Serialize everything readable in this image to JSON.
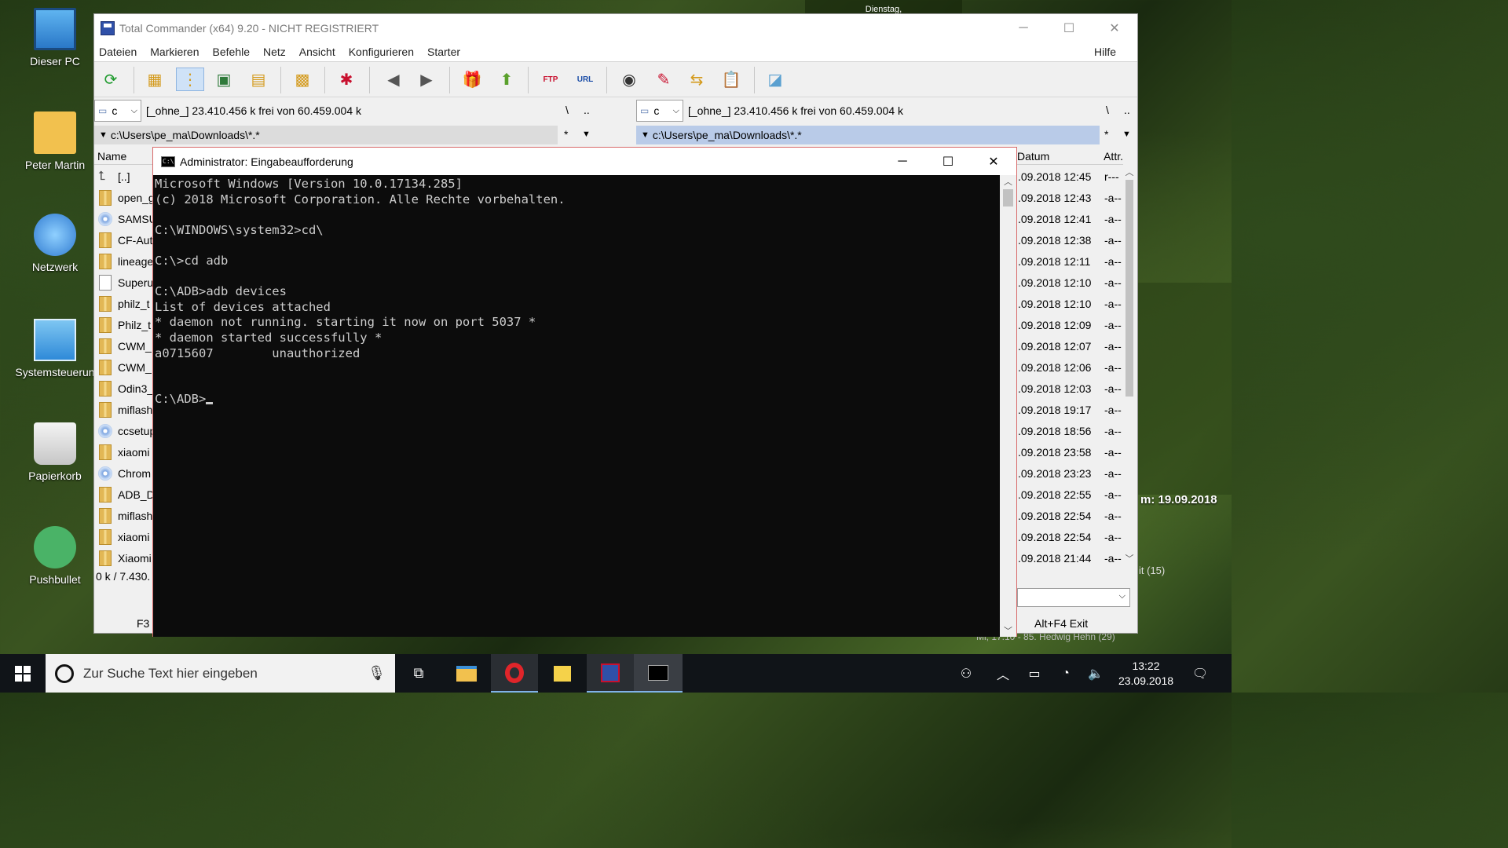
{
  "desktop": {
    "icons": [
      {
        "label": "Dieser PC",
        "icon": "computer-icon"
      },
      {
        "label": "Peter Martin",
        "icon": "user-folder-icon"
      },
      {
        "label": "Netzwerk",
        "icon": "network-globe-icon"
      },
      {
        "label": "Systemsteuerun",
        "icon": "control-panel-icon"
      },
      {
        "label": "Papierkorb",
        "icon": "recycle-bin-icon"
      },
      {
        "label": "Pushbullet",
        "icon": "pushbullet-icon"
      }
    ],
    "widget": {
      "day": "Dienstag,",
      "date_line": "m: 19.09.2018",
      "count": "it (15)",
      "footer": "Mi, 17.10 - 85. Hedwig Hehn (29)"
    }
  },
  "tc": {
    "title": "Total Commander (x64) 9.20 - NICHT REGISTRIERT",
    "menu": [
      "Dateien",
      "Markieren",
      "Befehle",
      "Netz",
      "Ansicht",
      "Konfigurieren",
      "Starter"
    ],
    "help": "Hilfe",
    "left": {
      "drive": "c",
      "drive_info": "[_ohne_]  23.410.456 k frei von 60.459.004 k",
      "root": "\\",
      "up": "..",
      "path": "c:\\Users\\pe_ma\\Downloads\\*.*",
      "filter": "*",
      "col_name": "Name",
      "files": [
        {
          "name": "[..]",
          "type": "up"
        },
        {
          "name": "open_g",
          "type": "folder"
        },
        {
          "name": "SAMSU",
          "type": "cd"
        },
        {
          "name": "CF-Aut",
          "type": "folder"
        },
        {
          "name": "lineage",
          "type": "folder"
        },
        {
          "name": "Superu",
          "type": "file"
        },
        {
          "name": "philz_t",
          "type": "folder"
        },
        {
          "name": "Philz_t",
          "type": "folder"
        },
        {
          "name": "CWM_",
          "type": "folder"
        },
        {
          "name": "CWM_",
          "type": "folder"
        },
        {
          "name": "Odin3_",
          "type": "folder"
        },
        {
          "name": "miflash",
          "type": "folder"
        },
        {
          "name": "ccsetup",
          "type": "cd"
        },
        {
          "name": "xiaomi",
          "type": "folder"
        },
        {
          "name": "Chrom",
          "type": "cd"
        },
        {
          "name": "ADB_D",
          "type": "folder"
        },
        {
          "name": "miflash",
          "type": "folder"
        },
        {
          "name": "xiaomi",
          "type": "folder"
        },
        {
          "name": "Xiaomi",
          "type": "folder"
        }
      ],
      "status": "0 k / 7.430.",
      "fkey": "F3"
    },
    "right": {
      "drive": "c",
      "drive_info": "[_ohne_]  23.410.456 k frei von 60.459.004 k",
      "root": "\\",
      "up": "..",
      "path": "c:\\Users\\pe_ma\\Downloads\\*.*",
      "filter": "*",
      "col_date": "Datum",
      "col_attr": "Attr.",
      "rows": [
        {
          "date": ".09.2018 12:45",
          "attr": "r---"
        },
        {
          "date": ".09.2018 12:43",
          "attr": "-a--"
        },
        {
          "date": ".09.2018 12:41",
          "attr": "-a--"
        },
        {
          "date": ".09.2018 12:38",
          "attr": "-a--"
        },
        {
          "date": ".09.2018 12:11",
          "attr": "-a--"
        },
        {
          "date": ".09.2018 12:10",
          "attr": "-a--"
        },
        {
          "date": ".09.2018 12:10",
          "attr": "-a--"
        },
        {
          "date": ".09.2018 12:09",
          "attr": "-a--"
        },
        {
          "date": ".09.2018 12:07",
          "attr": "-a--"
        },
        {
          "date": ".09.2018 12:06",
          "attr": "-a--"
        },
        {
          "date": ".09.2018 12:03",
          "attr": "-a--"
        },
        {
          "date": ".09.2018 19:17",
          "attr": "-a--"
        },
        {
          "date": ".09.2018 18:56",
          "attr": "-a--"
        },
        {
          "date": ".09.2018 23:58",
          "attr": "-a--"
        },
        {
          "date": ".09.2018 23:23",
          "attr": "-a--"
        },
        {
          "date": ".09.2018 22:55",
          "attr": "-a--"
        },
        {
          "date": ".09.2018 22:54",
          "attr": "-a--"
        },
        {
          "date": ".09.2018 22:54",
          "attr": "-a--"
        },
        {
          "date": ".09.2018 21:44",
          "attr": "-a--"
        }
      ],
      "fkey": "Alt+F4 Exit"
    }
  },
  "cmd": {
    "title": "Administrator: Eingabeaufforderung",
    "lines": [
      "Microsoft Windows [Version 10.0.17134.285]",
      "(c) 2018 Microsoft Corporation. Alle Rechte vorbehalten.",
      "",
      "C:\\WINDOWS\\system32>cd\\",
      "",
      "C:\\>cd adb",
      "",
      "C:\\ADB>adb devices",
      "List of devices attached",
      "* daemon not running. starting it now on port 5037 *",
      "* daemon started successfully *",
      "a0715607        unauthorized",
      "",
      ""
    ],
    "prompt": "C:\\ADB>"
  },
  "taskbar": {
    "search_placeholder": "Zur Suche Text hier eingeben",
    "time": "13:22",
    "date": "23.09.2018"
  }
}
